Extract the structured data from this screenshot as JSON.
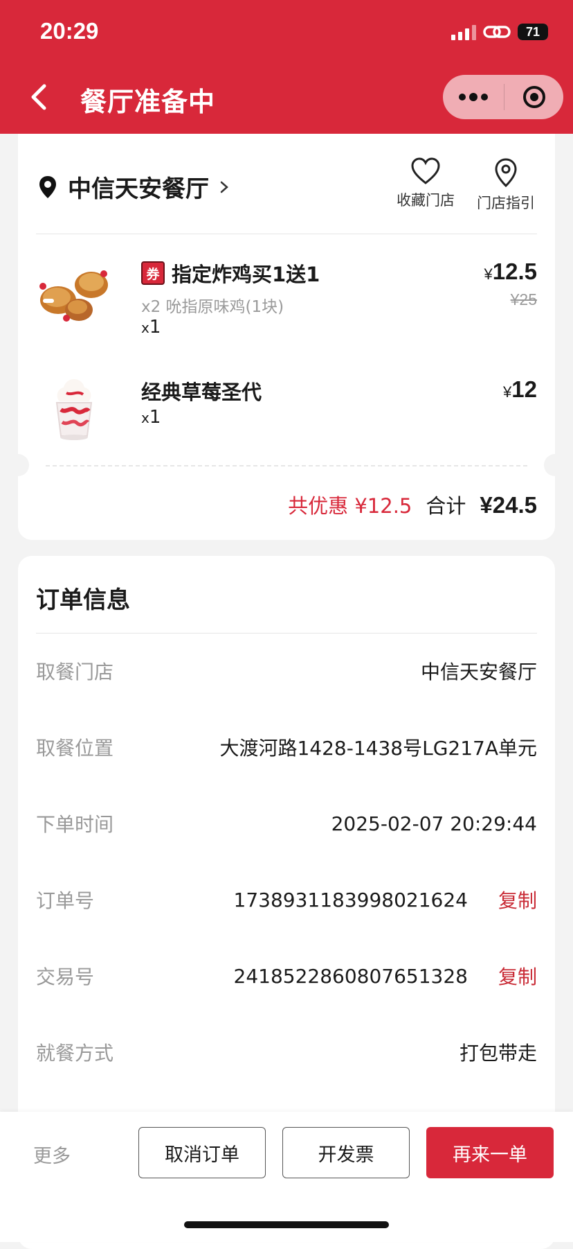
{
  "status_bar": {
    "time": "20:29",
    "battery": "71"
  },
  "header": {
    "title": "餐厅准备中"
  },
  "store": {
    "name": "中信天安餐厅",
    "favorite_label": "收藏门店",
    "guide_label": "门店指引"
  },
  "items": [
    {
      "badge": "券",
      "name": "指定炸鸡买1送1",
      "sub": "x2 吮指原味鸡(1块)",
      "qty_prefix": "x",
      "qty": "1",
      "currency": "¥",
      "price": "12.5",
      "original_price": "¥25"
    },
    {
      "name": "经典草莓圣代",
      "qty_prefix": "x",
      "qty": "1",
      "currency": "¥",
      "price": "12"
    }
  ],
  "totals": {
    "discount": "共优惠 ¥12.5",
    "total_label": "合计",
    "total_value": "¥24.5"
  },
  "order_info": {
    "title": "订单信息",
    "rows": [
      {
        "label": "取餐门店",
        "value": "中信天安餐厅"
      },
      {
        "label": "取餐位置",
        "value": "大渡河路1428-1438号LG217A单元"
      },
      {
        "label": "下单时间",
        "value": "2025-02-07 20:29:44"
      },
      {
        "label": "订单号",
        "value": "1738931183998021624",
        "action": "复制"
      },
      {
        "label": "交易号",
        "value": "2418522860807651328",
        "action": "复制"
      },
      {
        "label": "就餐方式",
        "value": "打包带走"
      }
    ]
  },
  "bottom_bar": {
    "more": "更多",
    "cancel": "取消订单",
    "invoice": "开发票",
    "reorder": "再来一单"
  },
  "colors": {
    "brand_red": "#d8283a",
    "copy_red": "#c92b36"
  }
}
